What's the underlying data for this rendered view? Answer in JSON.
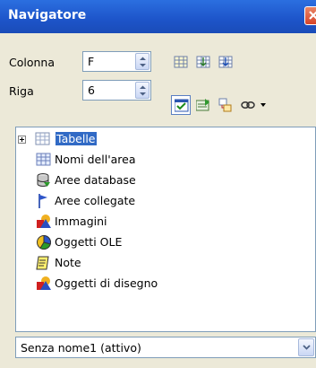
{
  "window": {
    "title": "Navigatore"
  },
  "fields": {
    "column_label": "Colonna",
    "column_value": "F",
    "row_label": "Riga",
    "row_value": "6"
  },
  "tree": {
    "items": [
      {
        "label": "Tabelle",
        "icon": "table-icon",
        "selected": true
      },
      {
        "label": "Nomi dell'area",
        "icon": "range-names-icon"
      },
      {
        "label": "Aree database",
        "icon": "database-icon"
      },
      {
        "label": "Aree collegate",
        "icon": "linked-areas-icon"
      },
      {
        "label": "Immagini",
        "icon": "images-icon"
      },
      {
        "label": "Oggetti OLE",
        "icon": "ole-objects-icon"
      },
      {
        "label": "Note",
        "icon": "note-icon"
      },
      {
        "label": "Oggetti di disegno",
        "icon": "drawing-objects-icon"
      }
    ]
  },
  "document_select": {
    "value": "Senza nome1 (attivo)"
  }
}
